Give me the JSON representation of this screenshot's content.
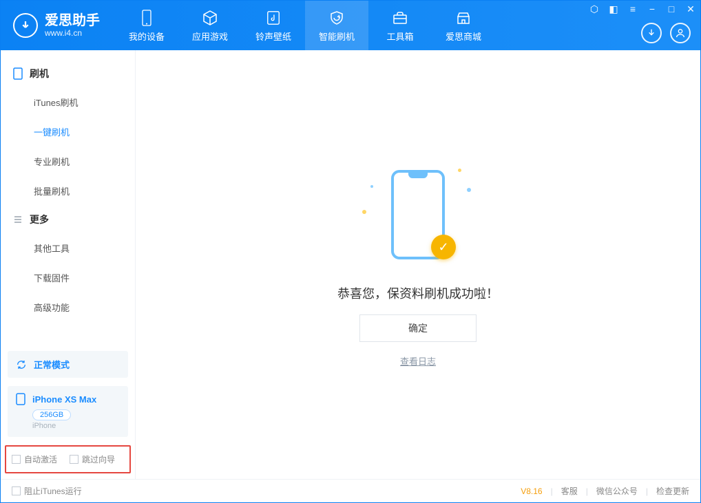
{
  "header": {
    "app_name": "爱思助手",
    "app_url": "www.i4.cn",
    "tabs": [
      {
        "label": "我的设备"
      },
      {
        "label": "应用游戏"
      },
      {
        "label": "铃声壁纸"
      },
      {
        "label": "智能刷机"
      },
      {
        "label": "工具箱"
      },
      {
        "label": "爱思商城"
      }
    ]
  },
  "sidebar": {
    "group1": {
      "title": "刷机",
      "items": [
        "iTunes刷机",
        "一键刷机",
        "专业刷机",
        "批量刷机"
      ]
    },
    "group2": {
      "title": "更多",
      "items": [
        "其他工具",
        "下载固件",
        "高级功能"
      ]
    },
    "mode": "正常模式",
    "device": {
      "name": "iPhone XS Max",
      "capacity": "256GB",
      "type": "iPhone"
    },
    "checks": [
      "自动激活",
      "跳过向导"
    ]
  },
  "main": {
    "success_text": "恭喜您，保资料刷机成功啦！",
    "ok_label": "确定",
    "log_link": "查看日志"
  },
  "footer": {
    "block_itunes": "阻止iTunes运行",
    "version": "V8.16",
    "links": [
      "客服",
      "微信公众号",
      "检查更新"
    ]
  }
}
